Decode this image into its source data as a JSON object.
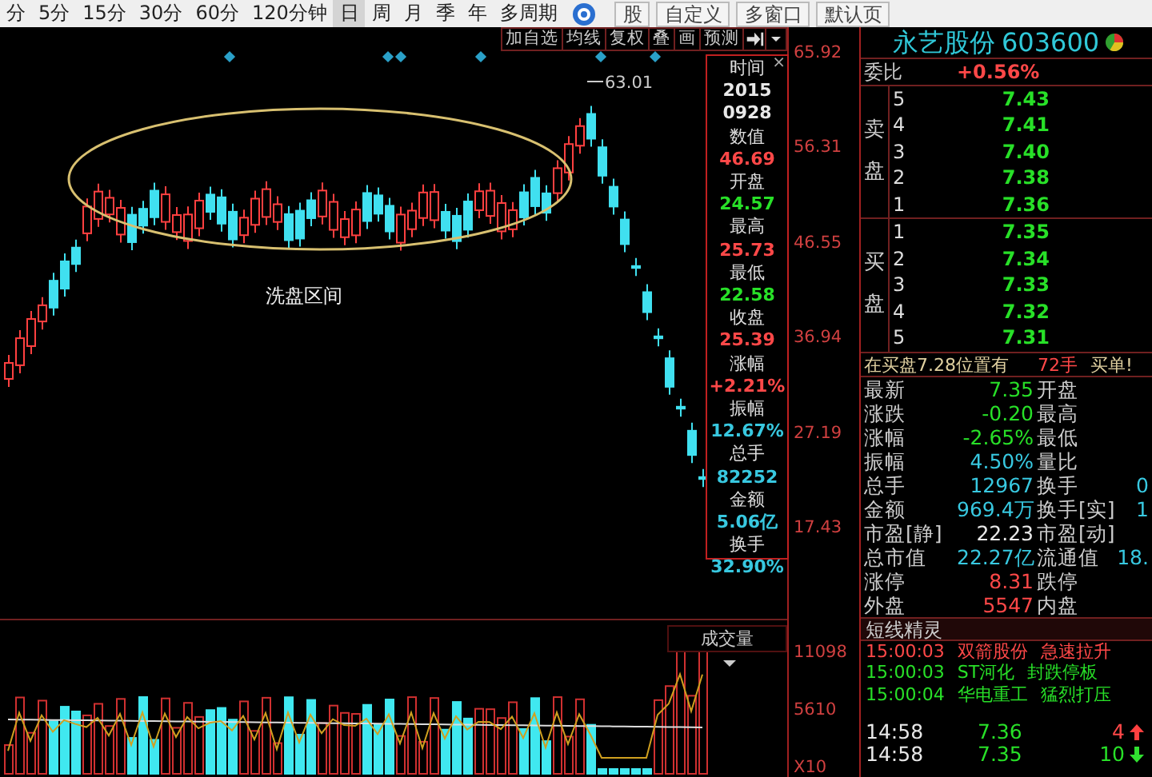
{
  "period_bar": {
    "items": [
      {
        "label": "分",
        "selected": false
      },
      {
        "label": "5分",
        "selected": false
      },
      {
        "label": "15分",
        "selected": false
      },
      {
        "label": "30分",
        "selected": false
      },
      {
        "label": "60分",
        "selected": false
      },
      {
        "label": "120分钟",
        "selected": false
      },
      {
        "label": "日",
        "selected": true
      },
      {
        "label": "周",
        "selected": false
      },
      {
        "label": "月",
        "selected": false
      },
      {
        "label": "季",
        "selected": false
      },
      {
        "label": "年",
        "selected": false
      },
      {
        "label": "多周期",
        "selected": false
      }
    ],
    "page_buttons": [
      "股",
      "自定义",
      "多窗口",
      "默认页"
    ]
  },
  "chart_toolbar": [
    "加自选",
    "均线",
    "复权",
    "叠",
    "画",
    "预测"
  ],
  "main_chart": {
    "axis_labels": [
      "65.92",
      "56.31",
      "46.55",
      "36.94",
      "27.19",
      "17.43"
    ],
    "peak_label": "63.01",
    "annotation": "洗盘区间"
  },
  "data_window": {
    "close": "×",
    "items": [
      {
        "label": "时间",
        "values": [
          "2015",
          "0928"
        ],
        "color": "#e8e8e8"
      },
      {
        "label": "数值",
        "values": [
          "46.69"
        ],
        "color": "#ff4848"
      },
      {
        "label": "开盘",
        "values": [
          "24.57"
        ],
        "color": "#28e028"
      },
      {
        "label": "最高",
        "values": [
          "25.73"
        ],
        "color": "#ff4848"
      },
      {
        "label": "最低",
        "values": [
          "22.58"
        ],
        "color": "#28e028"
      },
      {
        "label": "收盘",
        "values": [
          "25.39"
        ],
        "color": "#ff4848"
      },
      {
        "label": "涨幅",
        "values": [
          "+2.21%"
        ],
        "color": "#ff4848"
      },
      {
        "label": "振幅",
        "values": [
          "12.67%"
        ],
        "color": "#38c8e0"
      },
      {
        "label": "总手",
        "values": [
          "82252"
        ],
        "color": "#38c8e0"
      },
      {
        "label": "金额",
        "values": [
          "5.06亿"
        ],
        "color": "#38c8e0"
      },
      {
        "label": "换手",
        "values": [
          "32.90%"
        ],
        "color": "#38c8e0"
      }
    ]
  },
  "volume": {
    "title": "成交量",
    "axis_labels": [
      "11098",
      "5610",
      "X10"
    ]
  },
  "quote": {
    "name": "永艺股份",
    "code": "603600",
    "ratio_label": "委比",
    "ratio": "+0.56%",
    "sell_label": "卖盘",
    "sell": [
      {
        "rank": "5",
        "price": "7.43"
      },
      {
        "rank": "4",
        "price": "7.41"
      },
      {
        "rank": "3",
        "price": "7.40"
      },
      {
        "rank": "2",
        "price": "7.38"
      },
      {
        "rank": "1",
        "price": "7.36"
      }
    ],
    "buy_label": "买盘",
    "buy": [
      {
        "rank": "1",
        "price": "7.35"
      },
      {
        "rank": "2",
        "price": "7.34"
      },
      {
        "rank": "3",
        "price": "7.33"
      },
      {
        "rank": "4",
        "price": "7.32"
      },
      {
        "rank": "5",
        "price": "7.31"
      }
    ],
    "notice": {
      "text": "在买盘7.28位置有",
      "lots": "72手",
      "suffix": "买单!"
    },
    "stats": [
      {
        "label": "最新",
        "value": "7.35",
        "color": "#28e028",
        "label2": "开盘"
      },
      {
        "label": "涨跌",
        "value": "-0.20",
        "color": "#28e028",
        "label2": "最高"
      },
      {
        "label": "涨幅",
        "value": "-2.65%",
        "color": "#28e028",
        "label2": "最低"
      },
      {
        "label": "振幅",
        "value": "4.50%",
        "color": "#38c8e0",
        "label2": "量比"
      },
      {
        "label": "总手",
        "value": "12967",
        "color": "#38c8e0",
        "label2": "换手",
        "value2": "0"
      },
      {
        "label": "金额",
        "value": "969.4万",
        "color": "#38c8e0",
        "label2": "换手[实]",
        "value2": "1"
      },
      {
        "label": "市盈[静]",
        "value": "22.23",
        "color": "#e8e8e8",
        "label2": "市盈[动]"
      },
      {
        "label": "总市值",
        "value": "22.27亿",
        "color": "#38c8e0",
        "label2": "流通值",
        "value2": "18."
      },
      {
        "label": "涨停",
        "value": "8.31",
        "color": "#ff4848",
        "label2": "跌停"
      },
      {
        "label": "外盘",
        "value": "5547",
        "color": "#ff4848",
        "label2": "内盘"
      }
    ]
  },
  "alerts": {
    "title": "短线精灵",
    "rows": [
      {
        "time": "15:00:03",
        "stock": "双箭股份",
        "event": "急速拉升",
        "color": "#ff4848"
      },
      {
        "time": "15:00:03",
        "stock": "ST河化",
        "event": "封跌停板",
        "color": "#28e028"
      },
      {
        "time": "15:00:04",
        "stock": "华电重工",
        "event": "猛烈打压",
        "color": "#28e028"
      }
    ]
  },
  "ticks": [
    {
      "time": "14:58",
      "price": "7.36",
      "volume": "4",
      "rising": true
    },
    {
      "time": "14:58",
      "price": "7.35",
      "volume": "10",
      "rising": false
    }
  ]
}
